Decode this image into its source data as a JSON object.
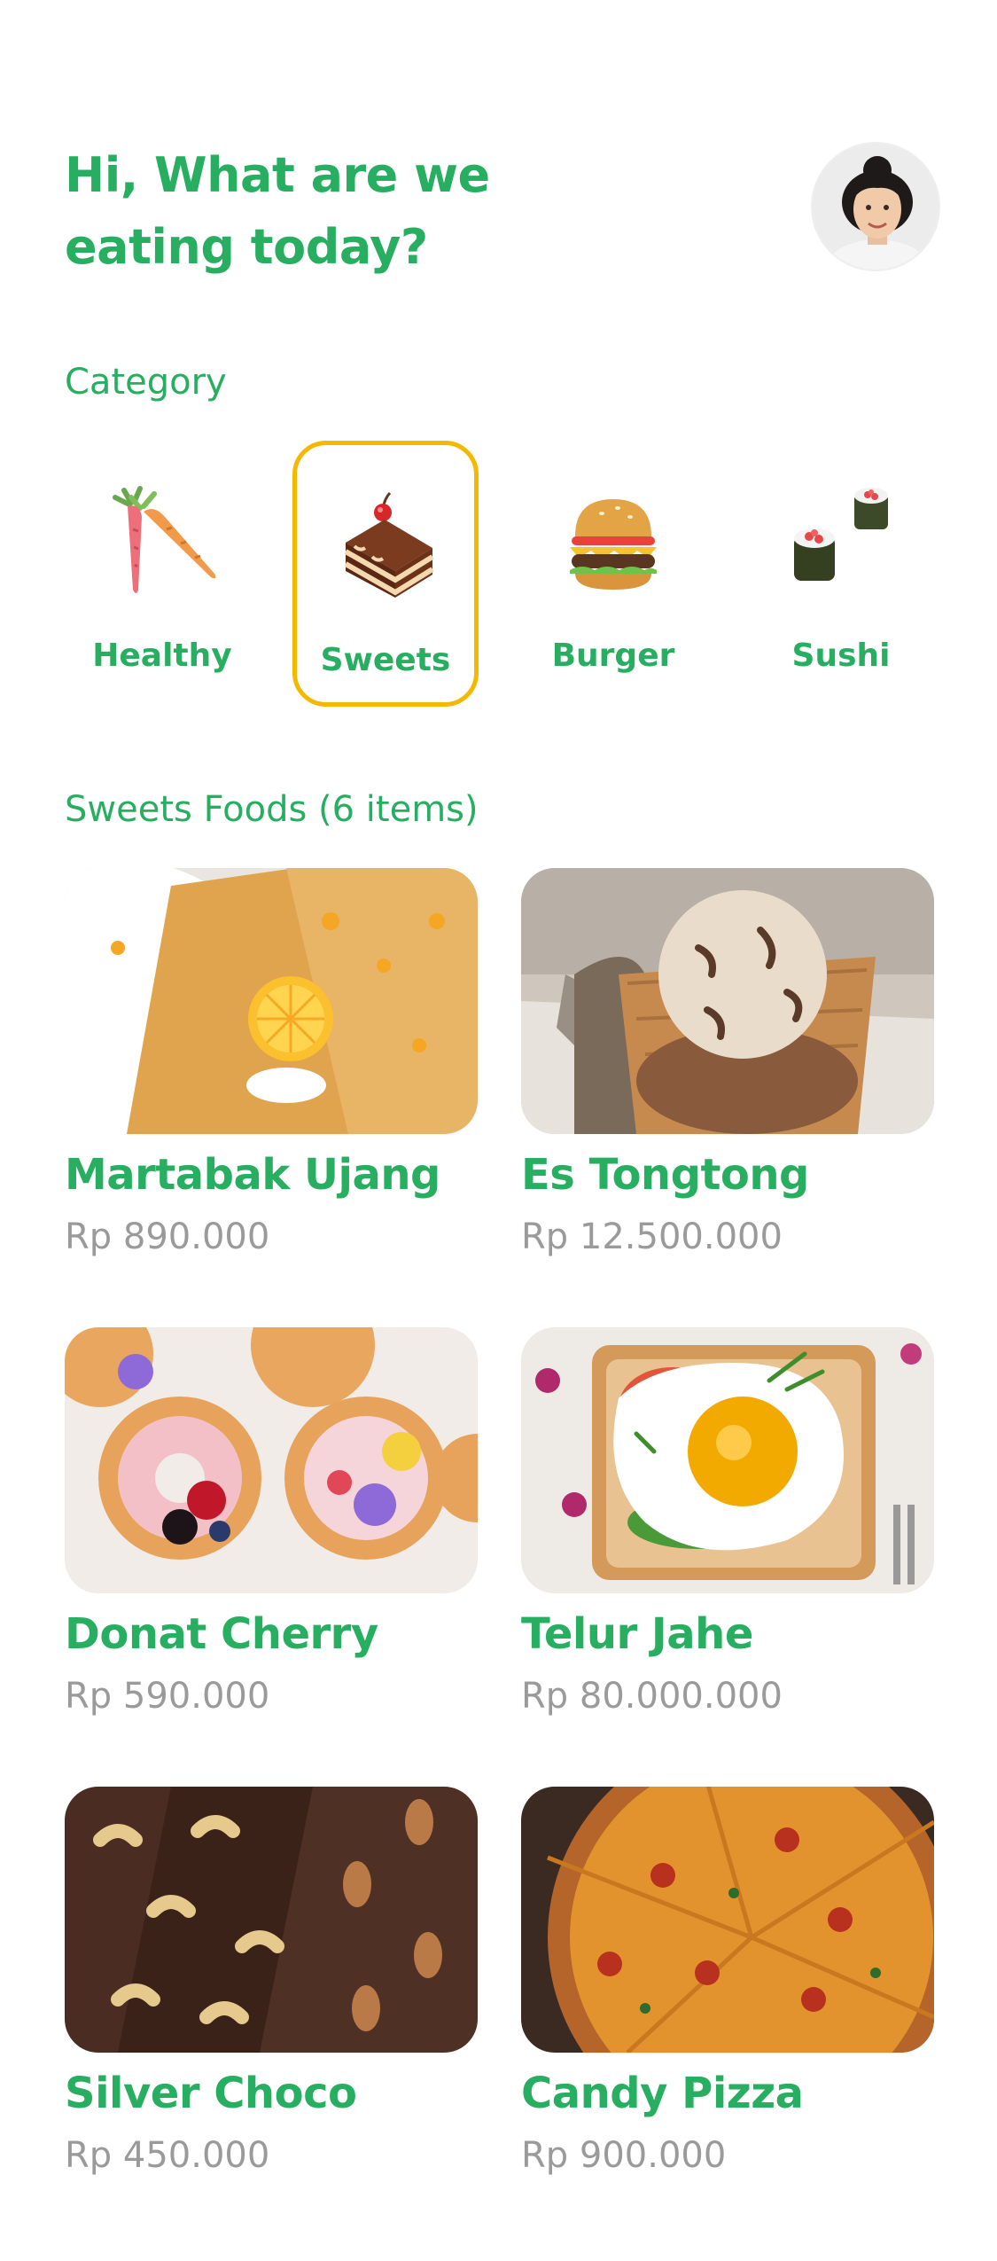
{
  "header": {
    "greeting": "Hi, What are we eating today?",
    "avatar_icon": "user-avatar"
  },
  "categories": {
    "title": "Category",
    "items": [
      {
        "label": "Healthy",
        "icon": "carrot-icon",
        "selected": false
      },
      {
        "label": "Sweets",
        "icon": "cake-slice-icon",
        "selected": true
      },
      {
        "label": "Burger",
        "icon": "burger-icon",
        "selected": false
      },
      {
        "label": "Sushi",
        "icon": "sushi-icon",
        "selected": false
      }
    ]
  },
  "foods": {
    "title": "Sweets Foods (6 items)",
    "items": [
      {
        "name": "Martabak Ujang",
        "price": "Rp 890.000"
      },
      {
        "name": "Es Tongtong",
        "price": "Rp 12.500.000"
      },
      {
        "name": "Donat Cherry",
        "price": "Rp 590.000"
      },
      {
        "name": "Telur Jahe",
        "price": "Rp 80.000.000"
      },
      {
        "name": "Silver Choco",
        "price": "Rp 450.000"
      },
      {
        "name": "Candy Pizza",
        "price": "Rp 900.000"
      }
    ]
  },
  "colors": {
    "primary": "#27ae60",
    "selected_border": "#f5b800",
    "price": "#9a9a9a"
  }
}
